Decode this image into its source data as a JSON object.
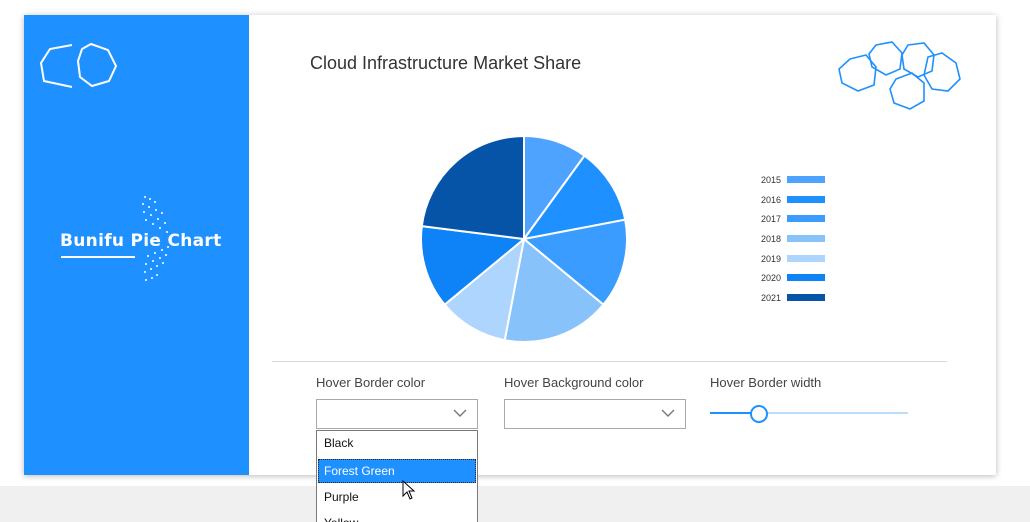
{
  "app": {
    "brand_title": "Bunifu Pie Chart",
    "chart_title": "Cloud Infrastructure Market Share"
  },
  "colors": {
    "accent": "#1e90ff",
    "sidebar": "#1e90ff",
    "selection": "#1e90ff"
  },
  "chart_data": {
    "type": "pie",
    "title": "Cloud Infrastructure Market Share",
    "legend_position": "right",
    "series": [
      {
        "name": "2015",
        "value": 10,
        "color": "#4da3ff"
      },
      {
        "name": "2016",
        "value": 12,
        "color": "#1e90ff"
      },
      {
        "name": "2017",
        "value": 14,
        "color": "#3b9cff"
      },
      {
        "name": "2018",
        "value": 17,
        "color": "#88c2fb"
      },
      {
        "name": "2019",
        "value": 11,
        "color": "#aed5fd"
      },
      {
        "name": "2020",
        "value": 13,
        "color": "#0d83f7"
      },
      {
        "name": "2021",
        "value": 23,
        "color": "#0654a8"
      }
    ]
  },
  "controls": {
    "hover_border_color": {
      "label": "Hover Border color",
      "value": ""
    },
    "hover_background_color": {
      "label": "Hover Background color",
      "value": ""
    },
    "hover_border_width": {
      "label": "Hover Border width",
      "value_fraction": 0.24
    }
  },
  "dropdown": {
    "options": [
      "Black",
      "Forest Green",
      "Purple",
      "Yellow"
    ],
    "selected_index": 1
  },
  "icons": {
    "sidebar_logo": "hexagon-logo-icon",
    "corner_logo": "hexagon-cluster-icon",
    "chevron": "chevron-down-icon",
    "cursor": "mouse-pointer-icon"
  }
}
